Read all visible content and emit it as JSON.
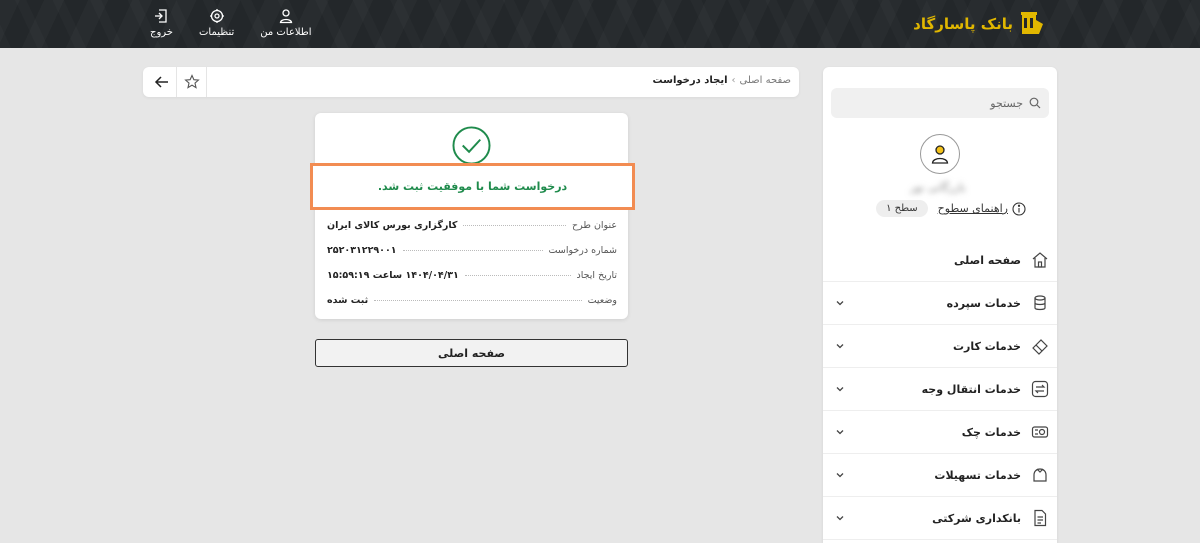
{
  "header": {
    "logo_text": "بانک پاسارگاد",
    "nav": [
      {
        "label": "اطلاعات من",
        "icon": "user-icon"
      },
      {
        "label": "تنظیمات",
        "icon": "gear-icon"
      },
      {
        "label": "خروج",
        "icon": "logout-icon"
      }
    ]
  },
  "sidebar": {
    "search_placeholder": "جستجو",
    "user_name": "بازرگانی نور",
    "guide_label": "راهنمای سطوح",
    "level_label": "سطح ۱",
    "menu": [
      {
        "label": "صفحه اصلی",
        "icon": "home-icon",
        "chevron": false
      },
      {
        "label": "خدمات سپرده",
        "icon": "coins-icon",
        "chevron": true
      },
      {
        "label": "خدمات کارت",
        "icon": "card-icon",
        "chevron": true
      },
      {
        "label": "خدمات انتقال وجه",
        "icon": "transfer-icon",
        "chevron": true
      },
      {
        "label": "خدمات چک",
        "icon": "cheque-icon",
        "chevron": true
      },
      {
        "label": "خدمات تسهیلات",
        "icon": "loan-icon",
        "chevron": true
      },
      {
        "label": "بانکداری شرکتی",
        "icon": "document-icon",
        "chevron": true
      }
    ]
  },
  "topbar": {
    "breadcrumb_home": "صفحه اصلی",
    "breadcrumb_sep": "›",
    "breadcrumb_current": "ایجاد درخواست"
  },
  "result": {
    "message": "درخواست شما با موفقیت ثبت شد.",
    "details": [
      {
        "label": "عنوان طرح",
        "value": "کارگزاری بورس کالای ایران"
      },
      {
        "label": "شماره درخواست",
        "value": "۲۵۲۰۳۱۲۲۹۰۰۱"
      },
      {
        "label": "تاریخ ایجاد",
        "value": "۱۴۰۴/۰۴/۳۱ ساعت ۱۵:۵۹:۱۹"
      },
      {
        "label": "وضعیت",
        "value": "ثبت شده"
      }
    ]
  },
  "home_button_label": "صفحه اصلی",
  "colors": {
    "header_bg": "#23272a",
    "brand_gold": "#e1b700",
    "success_green": "#1f8b4c",
    "highlight_orange": "#f28c52"
  }
}
